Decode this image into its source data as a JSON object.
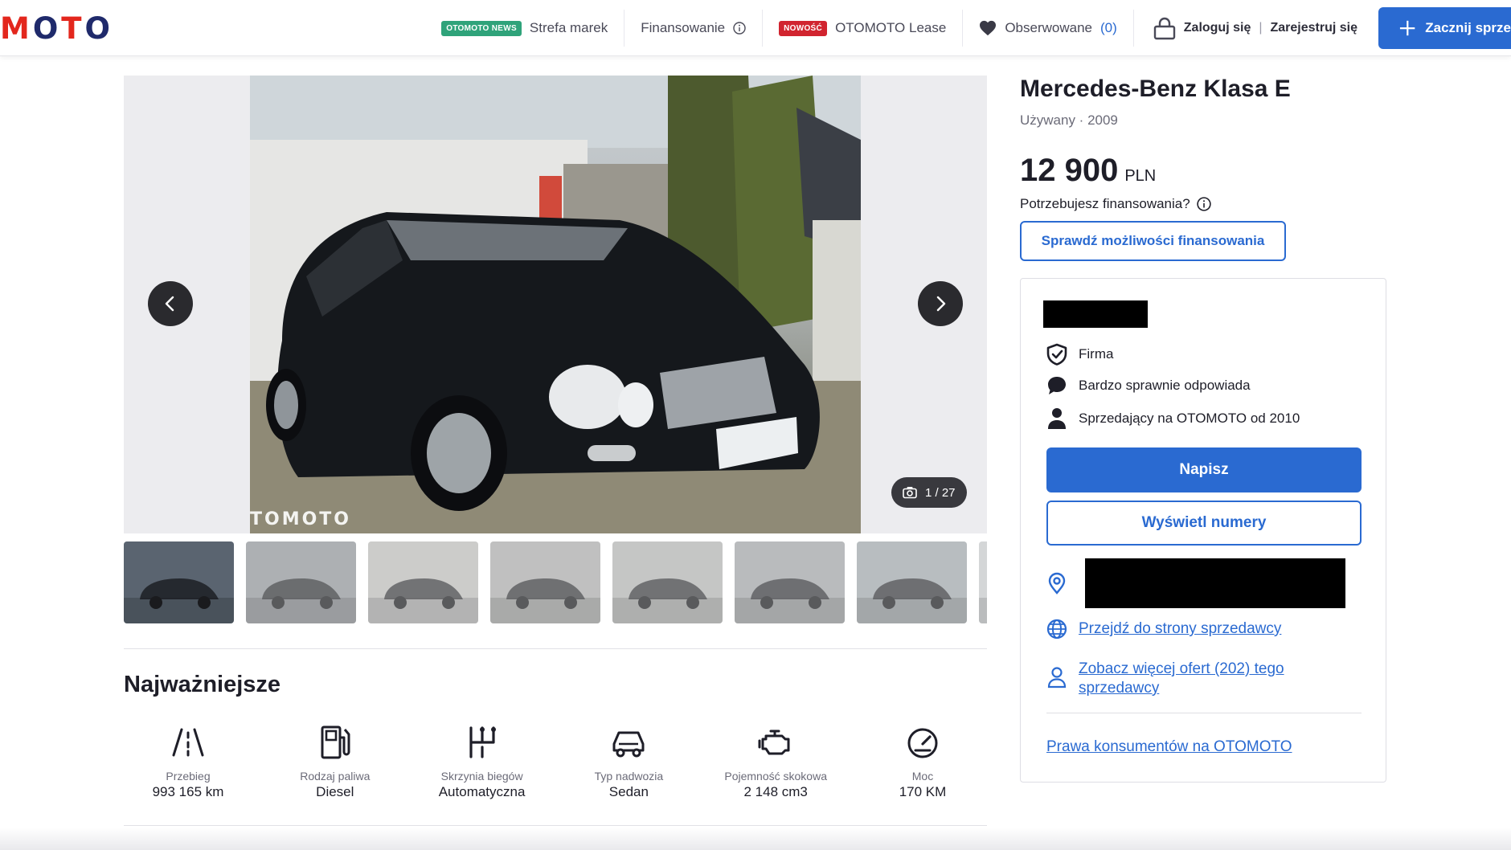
{
  "header": {
    "logo_text": "MOTO",
    "news_badge": "OTOMOTO NEWS",
    "brand_zone": "Strefa marek",
    "financing": "Finansowanie",
    "new_badge": "NOWOŚĆ",
    "lease": "OTOMOTO Lease",
    "watched": "Obserwowane",
    "watched_count": "(0)",
    "login": "Zaloguj się",
    "login_sep": "|",
    "register": "Zarejestruj się",
    "cta": "Zacznij sprze"
  },
  "gallery": {
    "counter": "1 / 27",
    "watermark": "TOMOTO",
    "thumbnail_count": 8
  },
  "listing": {
    "title": "Mercedes-Benz Klasa E",
    "subtitle": "Używany · 2009",
    "price": "12 900",
    "currency": "PLN",
    "financing_question": "Potrzebujesz finansowania?",
    "financing_button": "Sprawdź możliwości finansowania"
  },
  "seller": {
    "type": "Firma",
    "response": "Bardzo sprawnie odpowiada",
    "since": "Sprzedający na OTOMOTO od 2010",
    "write_button": "Napisz",
    "phone_button": "Wyświetl numery",
    "website_link": "Przejdź do strony sprzedawcy",
    "more_offers_link_1": "Zobacz więcej ofert (202) tego",
    "more_offers_link_2": "sprzedawcy",
    "consumer_rights": "Prawa konsumentów na OTOMOTO"
  },
  "highlights": {
    "title": "Najważniejsze",
    "items": [
      {
        "label": "Przebieg",
        "value": "993 165 km",
        "icon": "road-icon"
      },
      {
        "label": "Rodzaj paliwa",
        "value": "Diesel",
        "icon": "fuel-pump-icon"
      },
      {
        "label": "Skrzynia biegów",
        "value": "Automatyczna",
        "icon": "gearbox-icon"
      },
      {
        "label": "Typ nadwozia",
        "value": "Sedan",
        "icon": "car-body-icon"
      },
      {
        "label": "Pojemność skokowa",
        "value": "2 148 cm3",
        "icon": "engine-icon"
      },
      {
        "label": "Moc",
        "value": "170 KM",
        "icon": "speedometer-icon"
      }
    ]
  },
  "colors": {
    "accent": "#2a6ad1",
    "logo_red": "#e3271d",
    "logo_navy": "#1f2a6b",
    "news_badge": "#2fa37a",
    "new_badge": "#d1242f"
  }
}
